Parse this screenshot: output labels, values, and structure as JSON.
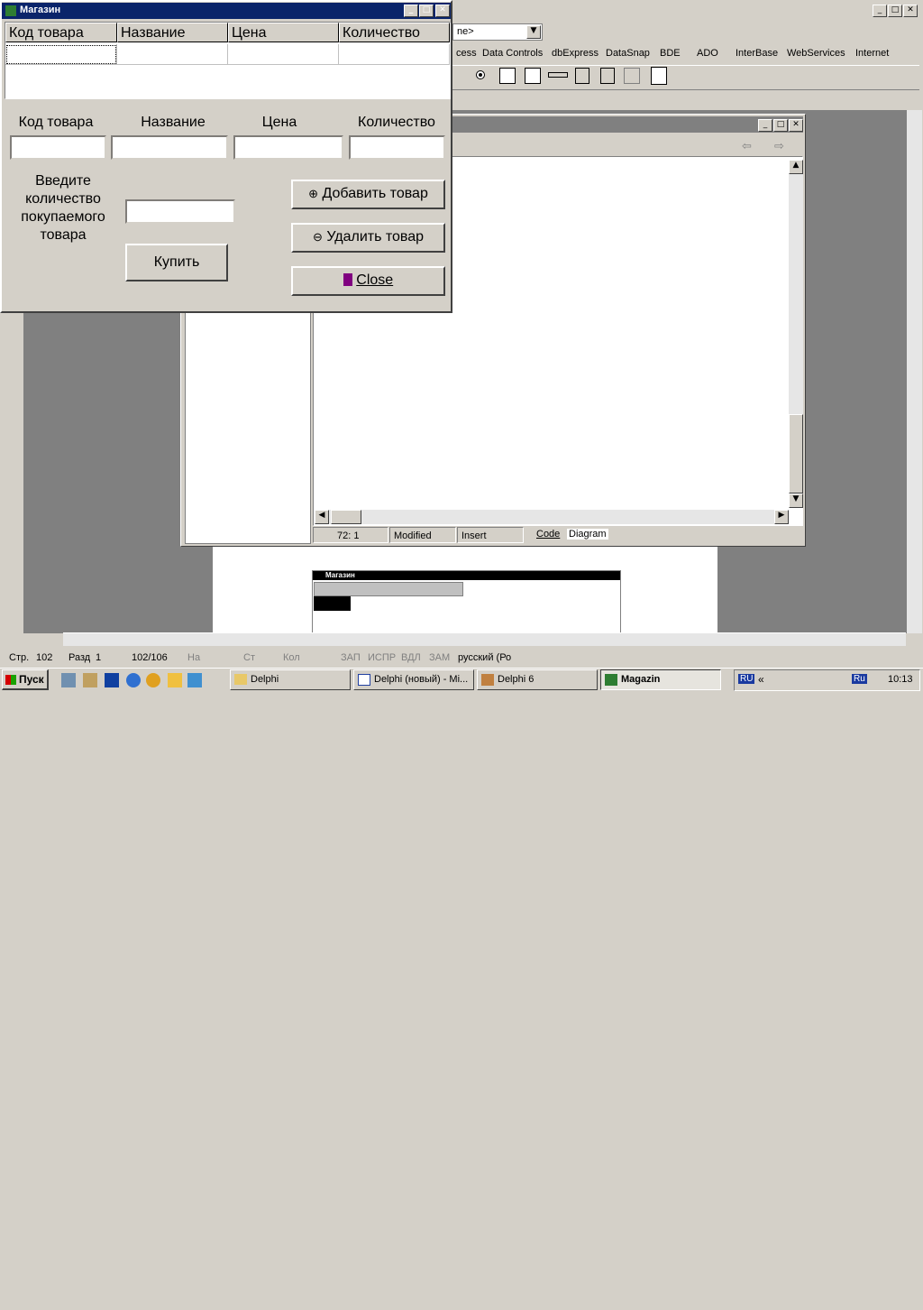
{
  "ide": {
    "combo_text": "ne>",
    "palette_tabs": [
      "cess",
      "Data Controls",
      "dbExpress",
      "DataSnap",
      "BDE",
      "ADO",
      "InterBase",
      "WebServices",
      "Internet"
    ],
    "editor_status": {
      "position": "72:   1",
      "state": "Modified",
      "mode": "Insert"
    },
    "editor_tabs": [
      "Code",
      "Diagram"
    ]
  },
  "word": {
    "status": {
      "page": "Стр.",
      "page_num": "102",
      "section": "Разд",
      "section_num": "1",
      "pages": "102/106",
      "at": "На",
      "line": "Ст",
      "col": "Кол",
      "rec": "ЗАП",
      "track": "ИСПР",
      "ext": "ВДЛ",
      "ovr": "ЗАМ",
      "lang": "русский (Ро"
    },
    "preview_title": "Магазин"
  },
  "form": {
    "title": "Магазин",
    "grid_headers": [
      "Код товара",
      "Название",
      "Цена",
      "Количество"
    ],
    "labels": {
      "code": "Код товара",
      "name": "Название",
      "price": "Цена",
      "qty": "Количество"
    },
    "fields": {
      "code": "",
      "name": "",
      "price": "",
      "qty": "",
      "buy_qty": ""
    },
    "prompt_lines": [
      "Введите",
      "количество",
      "покупаемого",
      "товара"
    ],
    "buy_button": "Купить",
    "add_button": "Добавить товар",
    "delete_button": "Удалить товар",
    "close_button": "Close"
  },
  "taskbar": {
    "start": "Пуск",
    "buttons": [
      "Delphi",
      "Delphi (новый) - Mi...",
      "Delphi 6",
      "Magazin"
    ],
    "lang": "RU",
    "tray_lang": "Ru",
    "clock": "10:13"
  }
}
